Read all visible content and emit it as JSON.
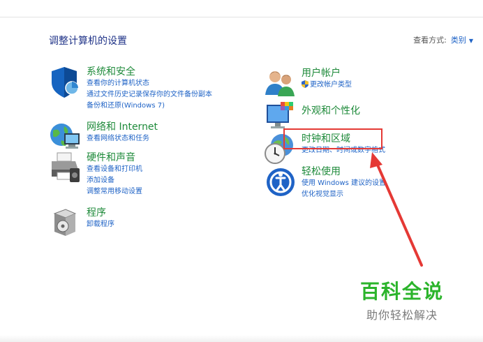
{
  "header": {
    "title": "调整计算机的设置",
    "view_by_label": "查看方式:",
    "view_by_value": "类别"
  },
  "categories": {
    "system_security": {
      "title": "系统和安全",
      "links": [
        "查看你的计算机状态",
        "通过文件历史记录保存你的文件备份副本",
        "备份和还原(Windows 7)"
      ]
    },
    "network": {
      "title": "网络和 Internet",
      "links": [
        "查看网络状态和任务"
      ]
    },
    "hardware": {
      "title": "硬件和声音",
      "links": [
        "查看设备和打印机",
        "添加设备",
        "调整常用移动设置"
      ]
    },
    "programs": {
      "title": "程序",
      "links": [
        "卸载程序"
      ]
    },
    "user_accounts": {
      "title": "用户帐户",
      "links": [
        "更改帐户类型"
      ]
    },
    "appearance": {
      "title": "外观和个性化",
      "links": []
    },
    "clock_region": {
      "title": "时钟和区域",
      "links": [
        "更改日期、时间或数字格式"
      ]
    },
    "ease_of_access": {
      "title": "轻松使用",
      "links": [
        "使用 Windows 建议的设置",
        "优化视觉显示"
      ]
    }
  },
  "watermark": {
    "brand": "百科全说",
    "slogan": "助你轻松解决"
  },
  "colors": {
    "title_green": "#1e8a3a",
    "link_blue": "#1f63c6",
    "annotation_red": "#e53935",
    "watermark_green": "#2bb42b"
  }
}
